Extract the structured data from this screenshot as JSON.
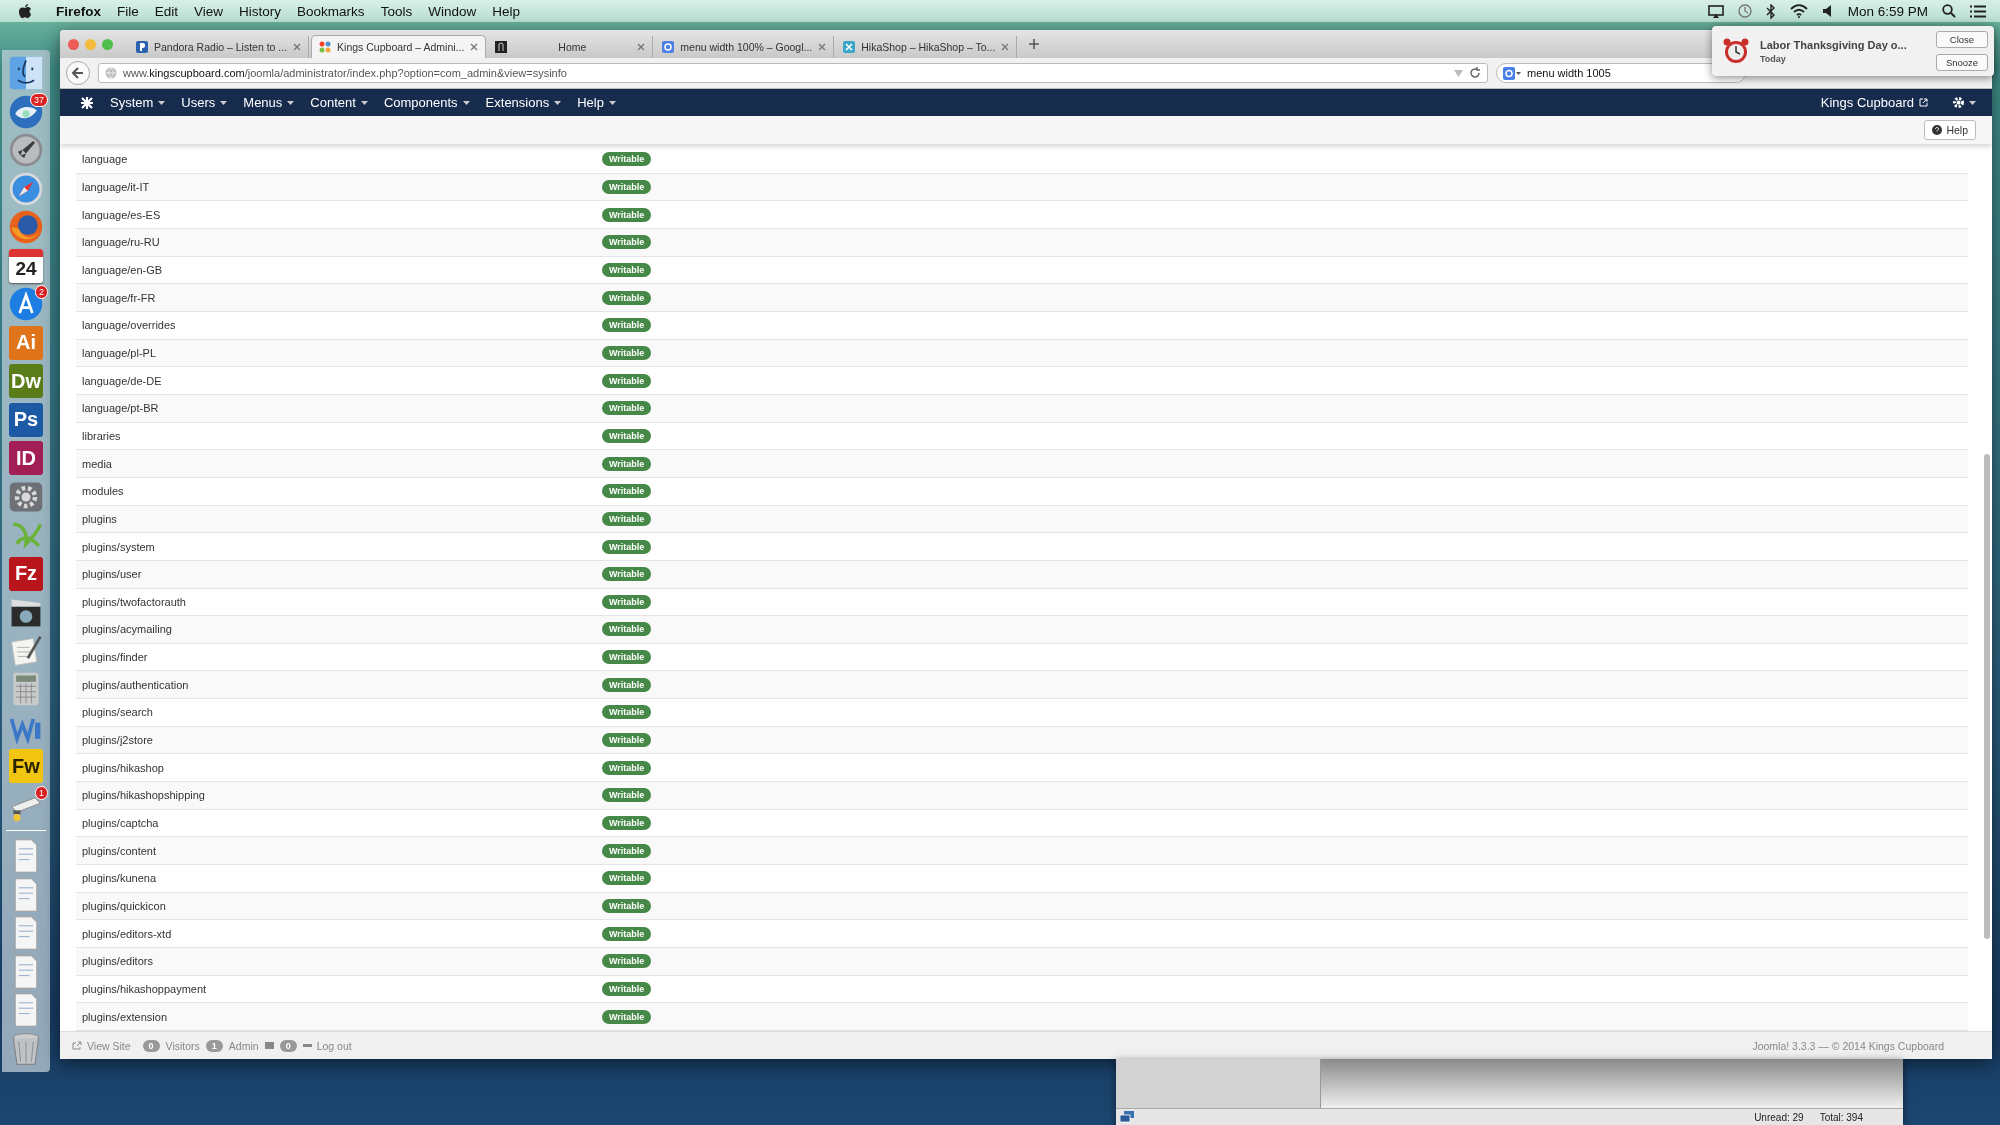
{
  "menubar": {
    "app": "Firefox",
    "items": [
      "File",
      "Edit",
      "View",
      "History",
      "Bookmarks",
      "Tools",
      "Window",
      "Help"
    ],
    "clock": "Mon 6:59 PM"
  },
  "dock": [
    {
      "kind": "finder"
    },
    {
      "kind": "mail",
      "badge": "37"
    },
    {
      "kind": "rocket"
    },
    {
      "kind": "compass"
    },
    {
      "kind": "firefox"
    },
    {
      "kind": "calendar",
      "label": "24"
    },
    {
      "kind": "appstore",
      "badge": "2"
    },
    {
      "kind": "lettered",
      "label": "Ai",
      "color": "#e0741a"
    },
    {
      "kind": "lettered",
      "label": "Dw",
      "color": "#5a7d1a"
    },
    {
      "kind": "lettered",
      "label": "Ps",
      "color": "#1c5aa5"
    },
    {
      "kind": "lettered",
      "label": "ID",
      "color": "#a21e55"
    },
    {
      "kind": "settings"
    },
    {
      "kind": "leaf"
    },
    {
      "kind": "lettered",
      "label": "Fz",
      "color": "#b8161c"
    },
    {
      "kind": "viewer"
    },
    {
      "kind": "pages"
    },
    {
      "kind": "calculator"
    },
    {
      "kind": "word"
    },
    {
      "kind": "lettered",
      "label": "Fw",
      "color": "#f2c511"
    },
    {
      "kind": "printer",
      "badge": "1"
    },
    {
      "kind": "separator"
    },
    {
      "kind": "document"
    },
    {
      "kind": "document"
    },
    {
      "kind": "document"
    },
    {
      "kind": "document"
    },
    {
      "kind": "document"
    },
    {
      "kind": "trash"
    }
  ],
  "browser": {
    "tabs": [
      {
        "title": "Pandora Radio – Listen to ...",
        "kind": "pandora",
        "selected": false
      },
      {
        "title": "Kings Cupboard – Admini...",
        "kind": "joomla",
        "selected": true
      },
      {
        "title": "Home",
        "kind": "dark",
        "selected": false
      },
      {
        "title": "menu width 100% – Googl...",
        "kind": "google",
        "selected": false
      },
      {
        "title": "HikaShop – HikaShop – To...",
        "kind": "hikashop",
        "selected": false
      }
    ],
    "url": "www.**kingscupboard.com**/joomla/administrator/index.php?option=com_admin&view=sysinfo",
    "search": "menu width 1005"
  },
  "notification": {
    "title": "Labor Thanksgiving Day o...",
    "subtitle": "Today",
    "buttons": [
      "Close",
      "Snooze"
    ]
  },
  "admin": {
    "menu": [
      "System",
      "Users",
      "Menus",
      "Content",
      "Components",
      "Extensions",
      "Help"
    ],
    "site_link": "Kings Cupboard",
    "help_button": "Help",
    "rows": [
      {
        "path": "language",
        "status": "Writable",
        "writable": true
      },
      {
        "path": "language/it-IT",
        "status": "Writable",
        "writable": true
      },
      {
        "path": "language/es-ES",
        "status": "Writable",
        "writable": true
      },
      {
        "path": "language/ru-RU",
        "status": "Writable",
        "writable": true
      },
      {
        "path": "language/en-GB",
        "status": "Writable",
        "writable": true
      },
      {
        "path": "language/fr-FR",
        "status": "Writable",
        "writable": true
      },
      {
        "path": "language/overrides",
        "status": "Writable",
        "writable": true
      },
      {
        "path": "language/pl-PL",
        "status": "Writable",
        "writable": true
      },
      {
        "path": "language/de-DE",
        "status": "Writable",
        "writable": true
      },
      {
        "path": "language/pt-BR",
        "status": "Writable",
        "writable": true
      },
      {
        "path": "libraries",
        "status": "Writable",
        "writable": true
      },
      {
        "path": "media",
        "status": "Writable",
        "writable": true
      },
      {
        "path": "modules",
        "status": "Writable",
        "writable": true
      },
      {
        "path": "plugins",
        "status": "Writable",
        "writable": true
      },
      {
        "path": "plugins/system",
        "status": "Writable",
        "writable": true
      },
      {
        "path": "plugins/user",
        "status": "Writable",
        "writable": true
      },
      {
        "path": "plugins/twofactorauth",
        "status": "Writable",
        "writable": true
      },
      {
        "path": "plugins/acymailing",
        "status": "Writable",
        "writable": true
      },
      {
        "path": "plugins/finder",
        "status": "Writable",
        "writable": true
      },
      {
        "path": "plugins/authentication",
        "status": "Writable",
        "writable": true
      },
      {
        "path": "plugins/search",
        "status": "Writable",
        "writable": true
      },
      {
        "path": "plugins/j2store",
        "status": "Writable",
        "writable": true
      },
      {
        "path": "plugins/hikashop",
        "status": "Writable",
        "writable": true
      },
      {
        "path": "plugins/hikashopshipping",
        "status": "Writable",
        "writable": true
      },
      {
        "path": "plugins/captcha",
        "status": "Writable",
        "writable": true
      },
      {
        "path": "plugins/content",
        "status": "Writable",
        "writable": true
      },
      {
        "path": "plugins/kunena",
        "status": "Writable",
        "writable": true
      },
      {
        "path": "plugins/quickicon",
        "status": "Writable",
        "writable": true
      },
      {
        "path": "plugins/editors-xtd",
        "status": "Writable",
        "writable": true
      },
      {
        "path": "plugins/editors",
        "status": "Writable",
        "writable": true
      },
      {
        "path": "plugins/hikashoppayment",
        "status": "Writable",
        "writable": true
      },
      {
        "path": "plugins/extension",
        "status": "Writable",
        "writable": true
      }
    ],
    "footer": {
      "view_site": "View Site",
      "visitors_count": "0",
      "visitors": "Visitors",
      "admin_count": "1",
      "admin": "Admin",
      "messages_count": "0",
      "logout": "Log out",
      "credits": "Joomla! 3.3.3  —  © 2014 Kings Cupboard"
    }
  },
  "mail_window": {
    "unread": "Unread: 29",
    "total": "Total: 394"
  }
}
